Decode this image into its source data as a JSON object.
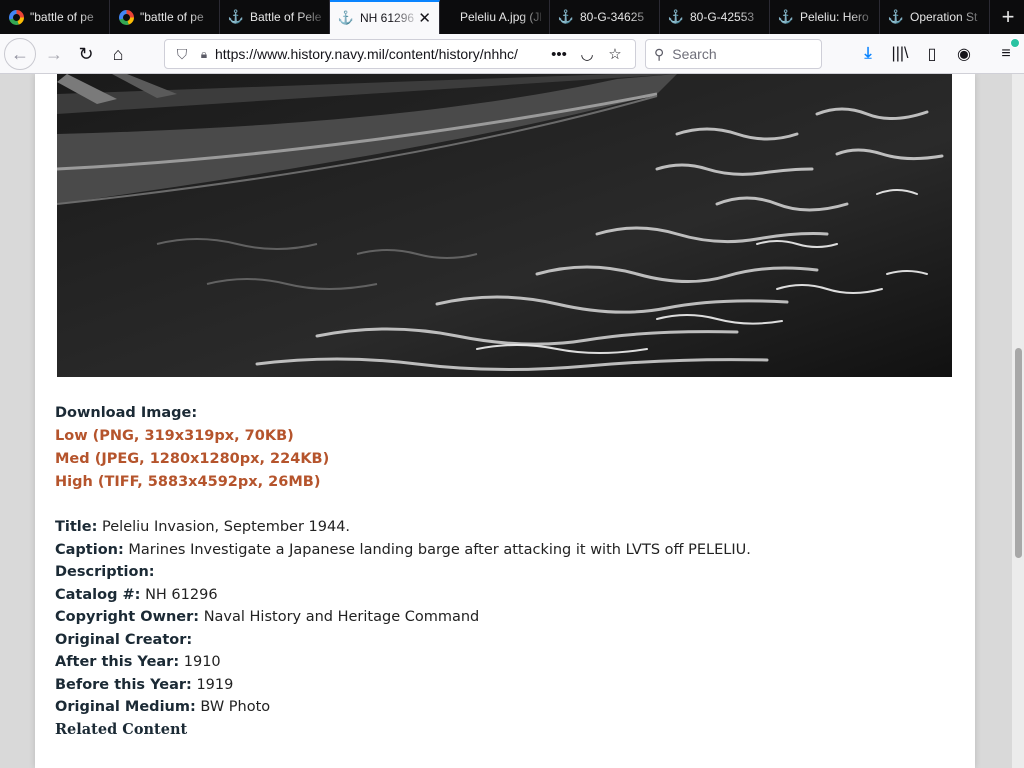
{
  "browser": {
    "tabs": [
      {
        "label": "\"battle of pe",
        "icon": "google-icon",
        "active": false
      },
      {
        "label": "\"battle of pe",
        "icon": "google-icon",
        "active": false
      },
      {
        "label": "Battle of Pele",
        "icon": "anchor-icon",
        "active": false
      },
      {
        "label": "NH 61296",
        "icon": "anchor-icon",
        "active": true
      },
      {
        "label": "Peleliu A.jpg (JPE",
        "icon": "none",
        "active": false
      },
      {
        "label": "80-G-34625",
        "icon": "anchor-icon",
        "active": false
      },
      {
        "label": "80-G-42553",
        "icon": "anchor-icon",
        "active": false
      },
      {
        "label": "Peleliu: Hero",
        "icon": "anchor-icon",
        "active": false
      },
      {
        "label": "Operation St",
        "icon": "anchor-icon",
        "active": false
      }
    ],
    "url": "https://www.history.navy.mil/content/history/nhhc/",
    "search_placeholder": "Search",
    "toolbar_icons": [
      "back-icon",
      "forward-icon",
      "reload-icon",
      "home-icon",
      "shield-icon",
      "lock-icon",
      "page-actions-icon",
      "pocket-icon",
      "bookmark-star-icon",
      "download-icon",
      "library-icon",
      "sidebar-icon",
      "account-icon",
      "hamburger-menu-icon"
    ],
    "accent_color": "#0a84ff"
  },
  "page": {
    "download": {
      "heading": "Download Image:",
      "links": [
        "Low (PNG, 319x319px, 70KB)",
        "Med (JPEG, 1280x1280px, 224KB)",
        "High (TIFF, 5883x4592px, 26MB)"
      ],
      "link_color": "#b5542c"
    },
    "metadata": [
      {
        "key": "Title:",
        "value": "Peleliu Invasion, September 1944."
      },
      {
        "key": "Caption:",
        "value": "Marines Investigate a Japanese landing barge after attacking it with LVTS off PELELIU."
      },
      {
        "key": "Description:",
        "value": ""
      },
      {
        "key": "Catalog #:",
        "value": "NH 61296"
      },
      {
        "key": "Copyright Owner:",
        "value": "Naval History and Heritage Command"
      },
      {
        "key": "Original Creator:",
        "value": ""
      },
      {
        "key": "After this Year:",
        "value": "1910"
      },
      {
        "key": "Before this Year:",
        "value": "1919"
      },
      {
        "key": "Original Medium:",
        "value": "BW Photo"
      }
    ],
    "related_heading": "Related Content"
  }
}
